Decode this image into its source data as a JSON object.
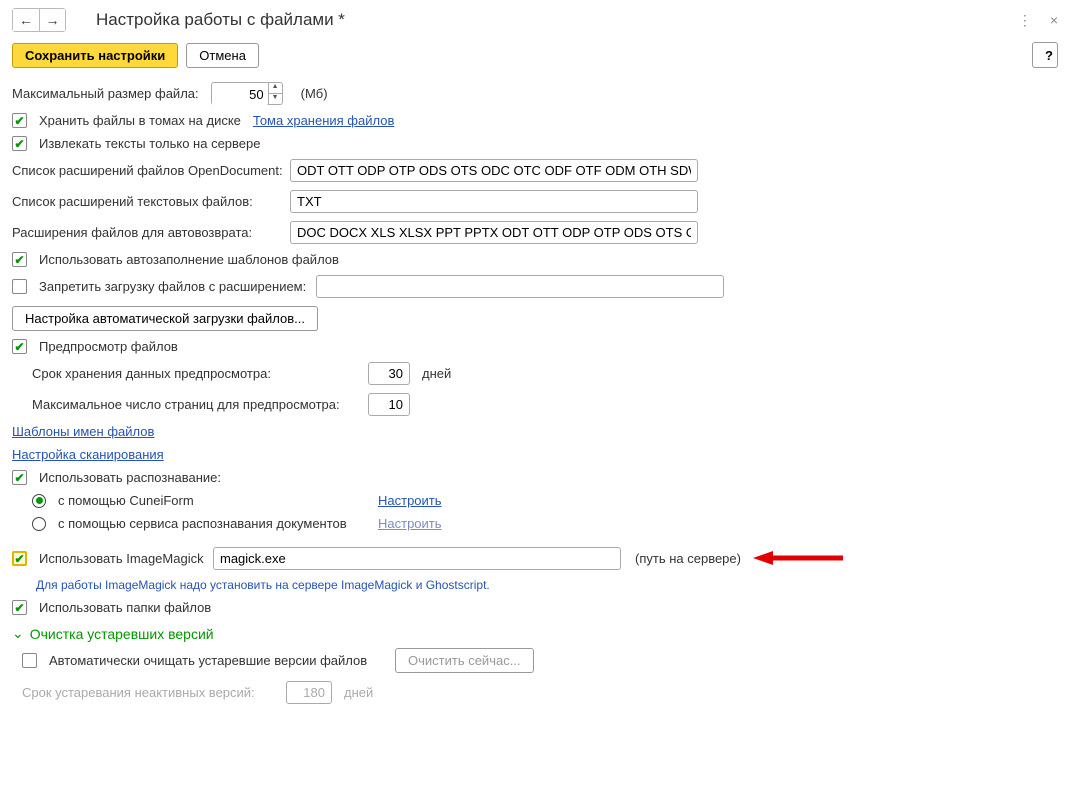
{
  "header": {
    "title": "Настройка работы с файлами *"
  },
  "actions": {
    "save": "Сохранить настройки",
    "cancel": "Отмена",
    "help": "?"
  },
  "maxSize": {
    "label": "Максимальный размер файла:",
    "value": "50",
    "unit": "(Мб)"
  },
  "storeInVolumes": {
    "label": "Хранить файлы в томах на диске",
    "link": "Тома хранения файлов"
  },
  "extractOnServer": {
    "label": "Извлекать тексты только на сервере"
  },
  "openDoc": {
    "label": "Список расширений файлов OpenDocument:",
    "value": "ODT OTT ODP OTP ODS OTS ODC OTC ODF OTF ODM OTH SDW"
  },
  "textExt": {
    "label": "Список расширений текстовых файлов:",
    "value": "TXT"
  },
  "autoRevert": {
    "label": "Расширения файлов для автовозврата:",
    "value": "DOC DOCX XLS XLSX PPT PPTX ODT OTT ODP OTP ODS OTS ODC"
  },
  "useTemplateAutofill": {
    "label": "Использовать автозаполнение шаблонов файлов"
  },
  "forbidExt": {
    "label": "Запретить загрузку файлов с расширением:"
  },
  "autoLoadBtn": "Настройка автоматической загрузки файлов...",
  "preview": {
    "label": "Предпросмотр файлов"
  },
  "previewRetain": {
    "label": "Срок хранения данных предпросмотра:",
    "value": "30",
    "unit": "дней"
  },
  "previewMaxPages": {
    "label": "Максимальное число страниц для предпросмотра:",
    "value": "10"
  },
  "links": {
    "nameTemplates": "Шаблоны имен файлов",
    "scanSettings": "Настройка сканирования"
  },
  "useRecognition": {
    "label": "Использовать распознавание:"
  },
  "recOpts": {
    "cuneiform": "с помощью CuneiForm",
    "service": "с помощью сервиса распознавания документов",
    "configure": "Настроить"
  },
  "imageMagick": {
    "label": "Использовать ImageMagick",
    "value": "magick.exe",
    "suffix": "(путь на сервере)",
    "note": "Для работы ImageMagick надо установить на сервере ImageMagick и Ghostscript."
  },
  "useFolders": {
    "label": "Использовать папки файлов"
  },
  "cleanup": {
    "title": "Очистка устаревших версий",
    "autoClean": "Автоматически очищать устаревшие версии файлов",
    "cleanNow": "Очистить сейчас...",
    "expiryLabel": "Срок устаревания неактивных версий:",
    "expiryValue": "180",
    "expiryUnit": "дней"
  }
}
